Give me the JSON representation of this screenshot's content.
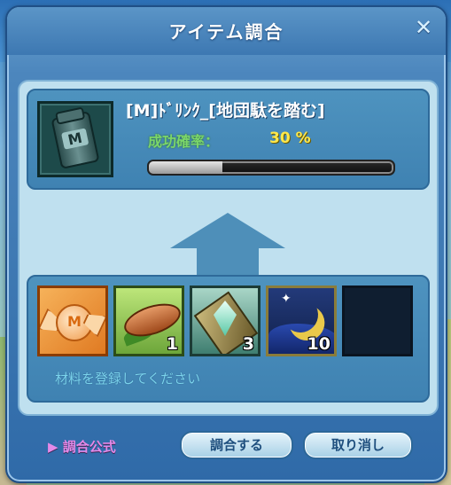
{
  "window": {
    "title": "アイテム調合",
    "close_label": "✕"
  },
  "result": {
    "item_name": "[M]ﾄﾞﾘﾝｸ_[地団駄を踏む]",
    "icon_letter": "M",
    "success_label": "成功確率：",
    "success_value": "30 %",
    "success_progress_percent": 30
  },
  "materials": {
    "slots": [
      {
        "icon": "candy-icon",
        "qty": "",
        "letter": "M"
      },
      {
        "icon": "cacao-pod-icon",
        "qty": "1"
      },
      {
        "icon": "crystal-card-icon",
        "qty": "3"
      },
      {
        "icon": "crescent-moon-icon",
        "qty": "10"
      },
      {
        "icon": "empty-slot",
        "qty": ""
      }
    ],
    "hint": "材料を登録してください"
  },
  "footer": {
    "formula_link": "▶ 調合公式",
    "combine_button": "調合する",
    "cancel_button": "取り消し"
  },
  "colors": {
    "title_text": "#ffffff",
    "success_label": "#7bd66a",
    "success_value": "#ffe84a",
    "hint_text": "#7bd3ec",
    "formula_link": "#e38ae8"
  }
}
